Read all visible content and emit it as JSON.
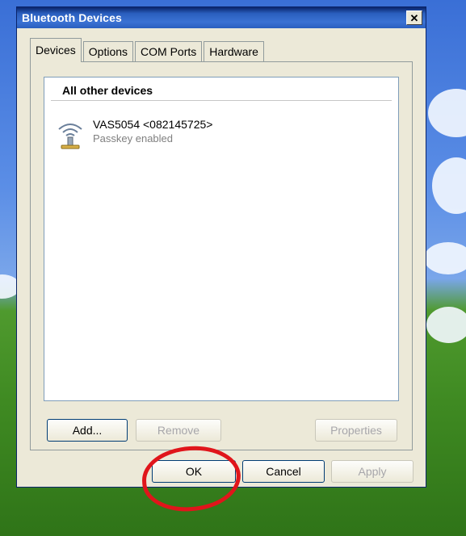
{
  "window": {
    "title": "Bluetooth Devices",
    "close_symbol": "✕"
  },
  "tabs": [
    {
      "label": "Devices",
      "active": true
    },
    {
      "label": "Options",
      "active": false
    },
    {
      "label": "COM Ports",
      "active": false
    },
    {
      "label": "Hardware",
      "active": false
    }
  ],
  "device_list": {
    "group_header": "All other devices",
    "devices": [
      {
        "name": "VAS5054 <082145725>",
        "status": "Passkey enabled",
        "icon": "bluetooth-device-icon"
      }
    ]
  },
  "panel_buttons": {
    "add": "Add...",
    "remove": "Remove",
    "properties": "Properties"
  },
  "dialog_buttons": {
    "ok": "OK",
    "cancel": "Cancel",
    "apply": "Apply"
  },
  "colors": {
    "titlebar": "#0a246a",
    "annotation": "#e0151b"
  }
}
